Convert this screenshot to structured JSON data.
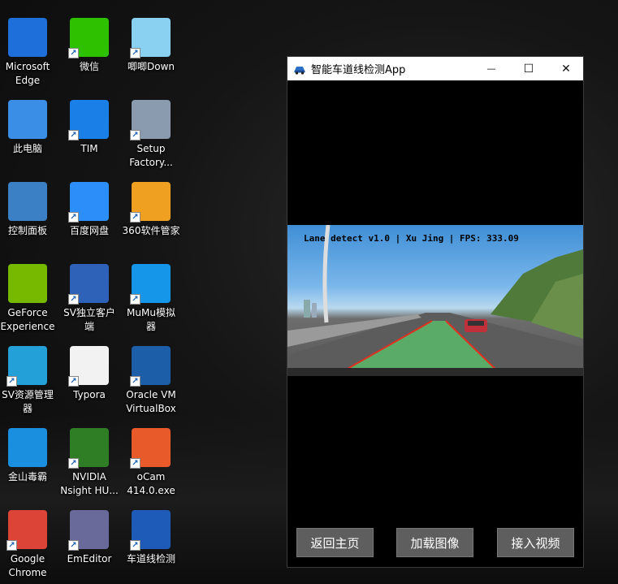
{
  "desktop": {
    "icons": [
      {
        "label": "Microsoft\nEdge",
        "icon": "edge-icon",
        "color": "#1e6fd9"
      },
      {
        "label": "微信",
        "icon": "wechat-icon",
        "color": "#2dc100"
      },
      {
        "label": "唧唧Down",
        "icon": "jijidown-icon",
        "color": "#8ad0f0"
      },
      {
        "label": "此电脑",
        "icon": "this-pc-icon",
        "color": "#3a8ee6"
      },
      {
        "label": "TIM",
        "icon": "tim-icon",
        "color": "#1b7fe8"
      },
      {
        "label": "Setup\nFactory...",
        "icon": "setup-factory-icon",
        "color": "#8a9bb0"
      },
      {
        "label": "控制面板",
        "icon": "control-panel-icon",
        "color": "#3b7fc4"
      },
      {
        "label": "百度网盘",
        "icon": "baidu-netdisk-icon",
        "color": "#2c8ef8"
      },
      {
        "label": "360软件管家",
        "icon": "360-software-icon",
        "color": "#f0a020"
      },
      {
        "label": "GeForce\nExperience",
        "icon": "geforce-icon",
        "color": "#76b900"
      },
      {
        "label": "SV独立客户\n端",
        "icon": "sv-client-icon",
        "color": "#2d62b8"
      },
      {
        "label": "MuMu模拟\n器",
        "icon": "mumu-icon",
        "color": "#1596e8"
      },
      {
        "label": "SV资源管理\n器",
        "icon": "sv-explorer-icon",
        "color": "#24a0d8"
      },
      {
        "label": "Typora",
        "icon": "typora-icon",
        "color": "#f2f2f2"
      },
      {
        "label": "Oracle VM\nVirtualBox",
        "icon": "virtualbox-icon",
        "color": "#1c5ea8"
      },
      {
        "label": "金山毒霸",
        "icon": "kingsoft-icon",
        "color": "#1a8fe0"
      },
      {
        "label": "NVIDIA\nNsight HU...",
        "icon": "nsight-icon",
        "color": "#2f7d24"
      },
      {
        "label": "oCam\n414.0.exe",
        "icon": "ocam-icon",
        "color": "#e85a2a"
      },
      {
        "label": "Google\nChrome",
        "icon": "chrome-icon",
        "color": "#db4437"
      },
      {
        "label": "EmEditor",
        "icon": "emeditor-icon",
        "color": "#6a6a9a"
      },
      {
        "label": "车道线检测",
        "icon": "car-app-icon",
        "color": "#1e5bb8"
      }
    ]
  },
  "app": {
    "title": "智能车道线检测App",
    "overlay": "Lane detect v1.0 | Xu Jing | FPS: 333.09",
    "buttons": {
      "back": "返回主页",
      "load": "加载图像",
      "video": "接入视频"
    },
    "minimize": "—",
    "maximize": "☐",
    "close": "✕"
  }
}
